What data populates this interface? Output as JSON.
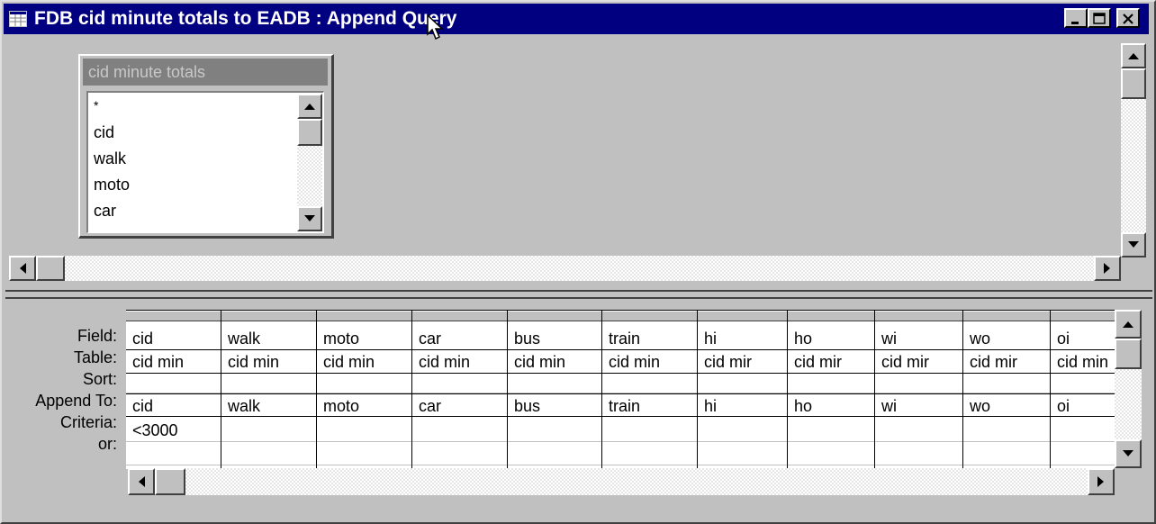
{
  "window": {
    "title": "FDB cid minute totals to EADB : Append Query",
    "controls": [
      "minimize-icon",
      "maximize-icon",
      "close-icon"
    ],
    "title_color": "#000080"
  },
  "table_pane": {
    "table": {
      "title": "cid minute totals",
      "fields": [
        "*",
        "cid",
        "walk",
        "moto",
        "car"
      ]
    }
  },
  "design_grid": {
    "row_labels": {
      "field": "Field:",
      "table": "Table:",
      "sort": "Sort:",
      "append_to": "Append To:",
      "criteria": "Criteria:",
      "or": "or:"
    },
    "columns": [
      {
        "field": "cid",
        "table": "cid min",
        "sort": "",
        "append_to": "cid",
        "criteria": "<3000",
        "or": ""
      },
      {
        "field": "walk",
        "table": "cid min",
        "sort": "",
        "append_to": "walk",
        "criteria": "",
        "or": ""
      },
      {
        "field": "moto",
        "table": "cid min",
        "sort": "",
        "append_to": "moto",
        "criteria": "",
        "or": ""
      },
      {
        "field": "car",
        "table": "cid min",
        "sort": "",
        "append_to": "car",
        "criteria": "",
        "or": ""
      },
      {
        "field": "bus",
        "table": "cid min",
        "sort": "",
        "append_to": "bus",
        "criteria": "",
        "or": ""
      },
      {
        "field": "train",
        "table": "cid min",
        "sort": "",
        "append_to": "train",
        "criteria": "",
        "or": ""
      },
      {
        "field": "hi",
        "table": "cid mir",
        "sort": "",
        "append_to": "hi",
        "criteria": "",
        "or": ""
      },
      {
        "field": "ho",
        "table": "cid mir",
        "sort": "",
        "append_to": "ho",
        "criteria": "",
        "or": ""
      },
      {
        "field": "wi",
        "table": "cid mir",
        "sort": "",
        "append_to": "wi",
        "criteria": "",
        "or": ""
      },
      {
        "field": "wo",
        "table": "cid mir",
        "sort": "",
        "append_to": "wo",
        "criteria": "",
        "or": ""
      },
      {
        "field": "oi",
        "table": "cid min",
        "sort": "",
        "append_to": "oi",
        "criteria": "",
        "or": ""
      }
    ]
  }
}
